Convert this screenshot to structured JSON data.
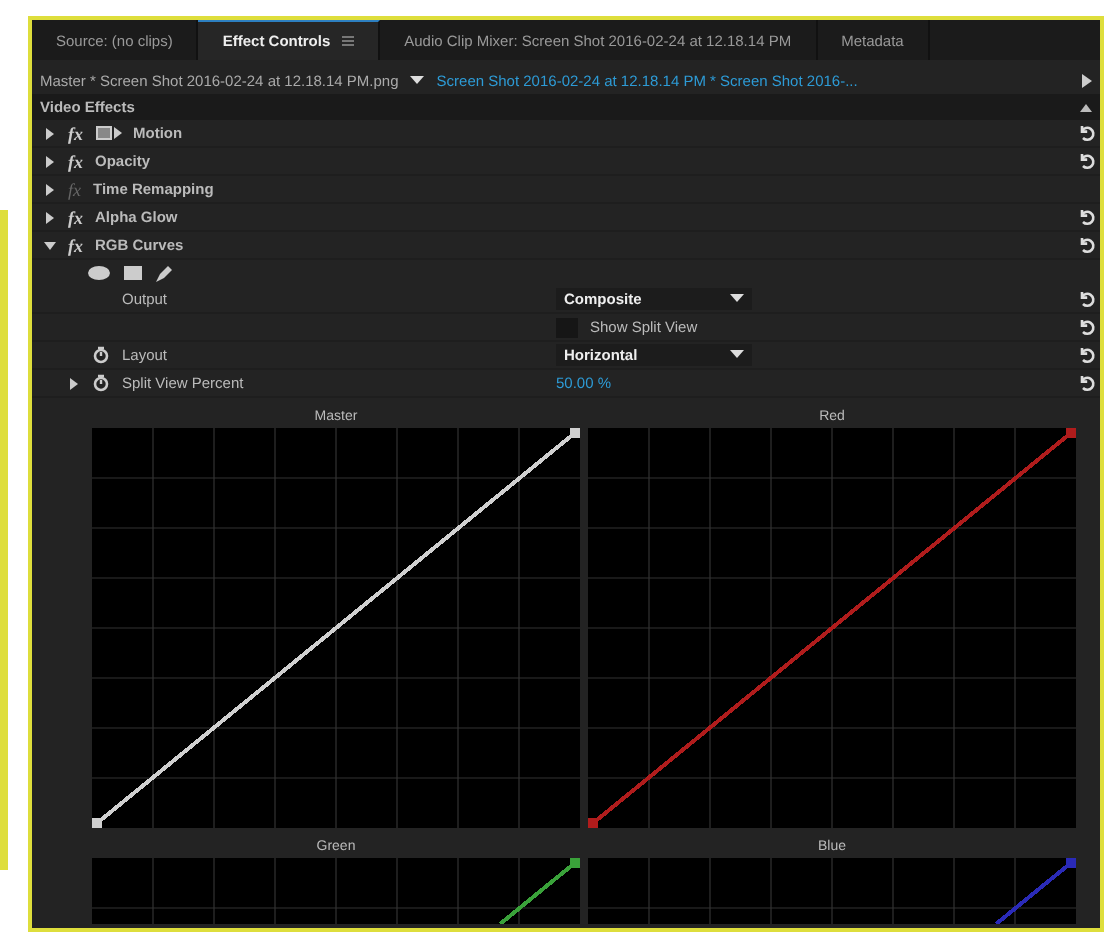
{
  "tabs": [
    {
      "label": "Source: (no clips)",
      "selected": false,
      "menu": false
    },
    {
      "label": "Effect Controls",
      "selected": true,
      "menu": true
    },
    {
      "label": "Audio Clip Mixer: Screen Shot 2016-02-24 at 12.18.14 PM",
      "selected": false,
      "menu": false
    },
    {
      "label": "Metadata",
      "selected": false,
      "menu": false
    }
  ],
  "source_row": {
    "master": "Master * Screen Shot 2016-02-24 at 12.18.14 PM.png",
    "clip": "Screen Shot 2016-02-24 at 12.18.14 PM * Screen Shot 2016-..."
  },
  "section_title": "Video Effects",
  "effects": [
    {
      "name": "Motion",
      "fx": "fx",
      "expanded": false,
      "fx_enabled": true,
      "motion_icon": true,
      "resettable": true
    },
    {
      "name": "Opacity",
      "fx": "fx",
      "expanded": false,
      "fx_enabled": true,
      "motion_icon": false,
      "resettable": true
    },
    {
      "name": "Time Remapping",
      "fx": "fx",
      "expanded": false,
      "fx_enabled": false,
      "motion_icon": false,
      "resettable": false
    },
    {
      "name": "Alpha Glow",
      "fx": "fx",
      "expanded": false,
      "fx_enabled": true,
      "motion_icon": false,
      "resettable": true
    },
    {
      "name": "RGB Curves",
      "fx": "fx",
      "expanded": true,
      "fx_enabled": true,
      "motion_icon": false,
      "resettable": true
    }
  ],
  "properties": [
    {
      "kind": "dropdown",
      "label": "Output",
      "value": "Composite",
      "animatable": false
    },
    {
      "kind": "checkbox",
      "label": "Show Split View",
      "checked": false,
      "animatable": false
    },
    {
      "kind": "dropdown",
      "label": "Layout",
      "value": "Horizontal",
      "animatable": true
    },
    {
      "kind": "value",
      "label": "Split View Percent",
      "value": "50.00 %",
      "animatable": true,
      "expanded": false
    }
  ],
  "curves": [
    {
      "title": "Master",
      "color": "#d0d0d0"
    },
    {
      "title": "Red",
      "color": "#b01c1c"
    },
    {
      "title": "Green",
      "color": "#3aa23a"
    },
    {
      "title": "Blue",
      "color": "#2a2ab8"
    }
  ]
}
